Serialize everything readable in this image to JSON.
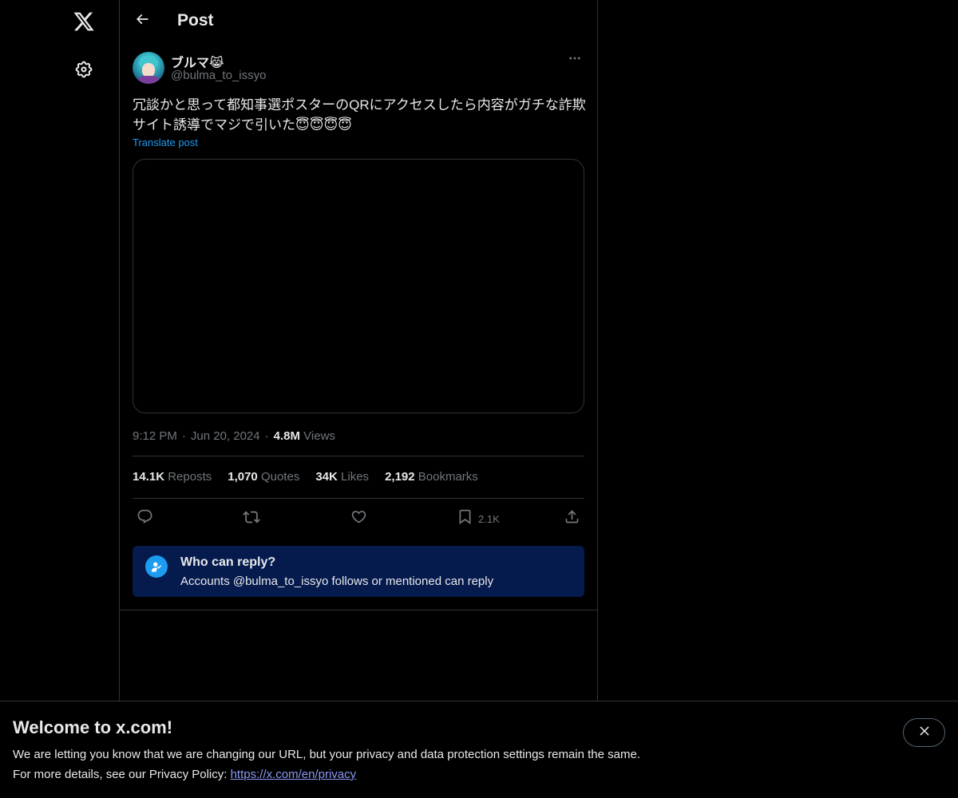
{
  "nav": {
    "logo_icon": "x-logo-icon",
    "settings_icon": "gear-icon"
  },
  "header": {
    "back_icon": "arrow-left-icon",
    "title": "Post"
  },
  "post": {
    "author_name": "ブルマ😹",
    "author_handle": "@bulma_to_issyo",
    "text": "冗談かと思って都知事選ポスターのQRにアクセスしたら内容がガチな詐欺サイト誘導でマジで引いた😇😇😇😇",
    "translate_label": "Translate post",
    "time": "9:12 PM",
    "date": "Jun 20, 2024",
    "views_count": "4.8M",
    "views_label": "Views",
    "separator": "·"
  },
  "stats": {
    "reposts_count": "14.1K",
    "reposts_label": "Reposts",
    "quotes_count": "1,070",
    "quotes_label": "Quotes",
    "likes_count": "34K",
    "likes_label": "Likes",
    "bookmarks_count": "2,192",
    "bookmarks_label": "Bookmarks"
  },
  "actions": {
    "reply_icon": "reply-icon",
    "repost_icon": "repost-icon",
    "like_icon": "heart-icon",
    "bookmark_icon": "bookmark-icon",
    "bookmark_count": "2.1K",
    "share_icon": "share-icon"
  },
  "who_can_reply": {
    "title": "Who can reply?",
    "description": "Accounts @bulma_to_issyo follows or mentioned can reply"
  },
  "banner": {
    "title": "Welcome to x.com!",
    "line1": "We are letting you know that we are changing our URL, but your privacy and data protection settings remain the same.",
    "line2_prefix": "For more details, see our Privacy Policy: ",
    "link": "https://x.com/en/privacy"
  },
  "colors": {
    "background": "#000000",
    "text": "#e7e9ea",
    "muted": "#71767b",
    "accent": "#1d9bf0",
    "reply_card": "#051a4d",
    "link": "#8b98f5"
  }
}
